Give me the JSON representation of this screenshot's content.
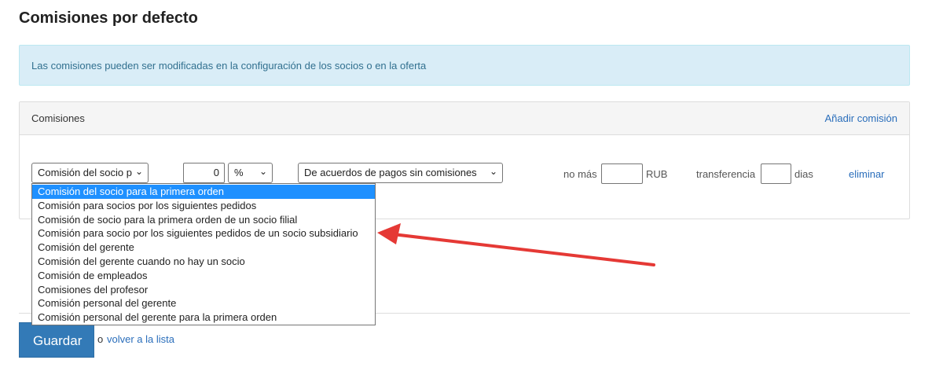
{
  "page": {
    "title": "Comisiones por defecto"
  },
  "info": {
    "text": "Las comisiones pueden ser modificadas en la configuración de los socios o en la oferta"
  },
  "panel": {
    "title": "Comisiones",
    "add_label": "Añadir comisión"
  },
  "row": {
    "type_select": "Comisión del socio p",
    "amount_value": "0",
    "unit_select": "%",
    "payment_select": "De acuerdos de pagos sin comisiones",
    "no_mas_label": "no más",
    "no_mas_value": "",
    "currency_label": "RUB",
    "transfer_label": "transferencia",
    "transfer_value": "",
    "days_label": "dias",
    "delete_label": "eliminar"
  },
  "dropdown": {
    "options": [
      "Comisión del socio para la primera orden",
      "Comisión para socios por los siguientes pedidos",
      "Comisión de socio para la primera orden de un socio filial",
      "Comisión para socio por los siguientes pedidos de un socio subsidiario",
      "Comisión del gerente",
      "Comisión del gerente cuando no hay un socio",
      "Comisión de empleados",
      "Comisiones del profesor",
      "Comisión personal del gerente",
      "Comisión personal del gerente para la primera orden"
    ],
    "selected_index": 0
  },
  "footer": {
    "save_label": "Guardar",
    "or_label": "o",
    "back_label": "volver a la lista"
  },
  "colors": {
    "accent": "#337ab7",
    "link": "#2a6ebb",
    "info_bg": "#d9edf7",
    "annotation_arrow": "#e53935",
    "selected_option": "#1e90ff"
  }
}
